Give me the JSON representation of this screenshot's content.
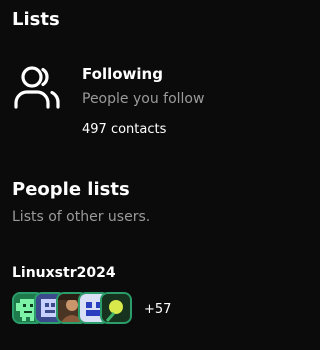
{
  "header": {
    "title": "Lists"
  },
  "following": {
    "title": "Following",
    "description": "People you follow",
    "count_text": "497 contacts",
    "icon": "people-icon"
  },
  "people_lists": {
    "title": "People lists",
    "subtitle": "Lists of other users.",
    "items": [
      {
        "name": "Linuxstr2024",
        "more_text": "+57",
        "avatar_icons": [
          "robot-avatar-icon",
          "pixel-avatar-icon",
          "photo-avatar-icon",
          "pixel-avatar-icon",
          "ball-avatar-icon"
        ]
      }
    ]
  },
  "colors": {
    "background": "#0b0b0b",
    "text": "#ffffff",
    "muted": "#9a9a9a",
    "avatar_border": "#2a9d6a"
  }
}
